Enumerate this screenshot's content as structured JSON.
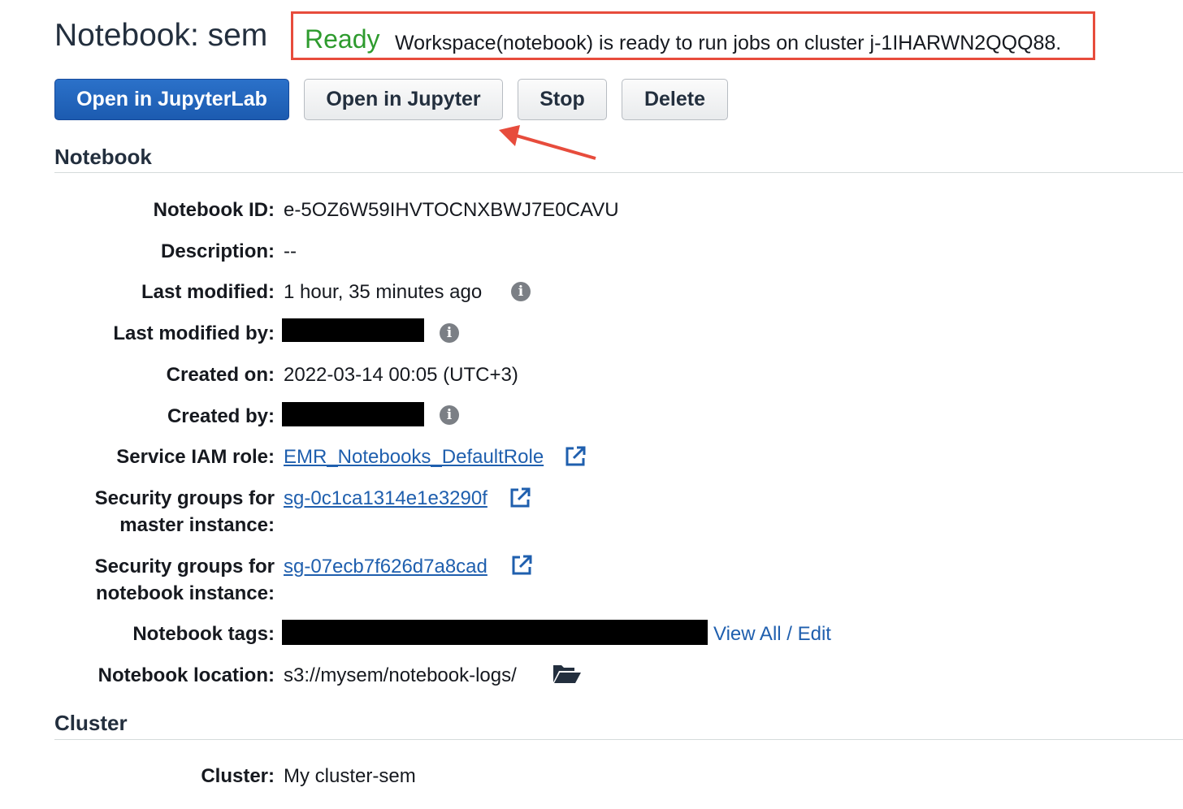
{
  "header": {
    "title": "Notebook: sem",
    "status_label": "Ready",
    "status_message": "Workspace(notebook) is ready to run jobs on cluster j-1IHARWN2QQQ88."
  },
  "actions": {
    "open_jupyterlab": "Open in JupyterLab",
    "open_jupyter": "Open in Jupyter",
    "stop": "Stop",
    "delete": "Delete"
  },
  "notebook_section": {
    "heading": "Notebook",
    "fields": {
      "notebook_id": {
        "label": "Notebook ID:",
        "value": "e-5OZ6W59IHVTOCNXBWJ7E0CAVU"
      },
      "description": {
        "label": "Description:",
        "value": "--"
      },
      "last_modified": {
        "label": "Last modified:",
        "value": "1 hour, 35 minutes ago"
      },
      "last_modified_by": {
        "label": "Last modified by:"
      },
      "created_on": {
        "label": "Created on:",
        "value": "2022-03-14 00:05 (UTC+3)"
      },
      "created_by": {
        "label": "Created by:"
      },
      "service_role": {
        "label": "Service IAM role:",
        "value": "EMR_Notebooks_DefaultRole"
      },
      "sg_master": {
        "label_line1": "Security groups for",
        "label_line2": "master instance:",
        "value": "sg-0c1ca1314e1e3290f"
      },
      "sg_notebook": {
        "label_line1": "Security groups for",
        "label_line2": "notebook instance:",
        "value": "sg-07ecb7f626d7a8cad"
      },
      "tags": {
        "label": "Notebook tags:",
        "link": "View All / Edit"
      },
      "location": {
        "label": "Notebook location:",
        "value": "s3://mysem/notebook-logs/"
      }
    }
  },
  "cluster_section": {
    "heading": "Cluster",
    "fields": {
      "cluster": {
        "label": "Cluster:",
        "value": "My cluster-sem"
      }
    }
  },
  "icons": {
    "info": "info-icon",
    "external_link": "external-link-icon",
    "folder": "folder-open-icon",
    "annotation_arrow": "arrow-icon"
  },
  "colors": {
    "primary_button": "#1c5bb0",
    "ready_green": "#2e9b2e",
    "annotation_red": "#e74c3c",
    "link_blue": "#1f5fae"
  }
}
